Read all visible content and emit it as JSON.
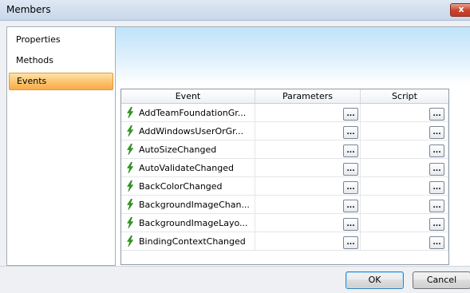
{
  "window": {
    "title": "Members",
    "close_label": "x"
  },
  "sidebar": {
    "items": [
      {
        "label": "Properties",
        "active": false
      },
      {
        "label": "Methods",
        "active": false
      },
      {
        "label": "Events",
        "active": true
      }
    ]
  },
  "grid": {
    "columns": [
      "Event",
      "Parameters",
      "Script"
    ],
    "rows": [
      {
        "event": "AddTeamFoundationGr...",
        "param_btn": "...",
        "script_btn": "..."
      },
      {
        "event": "AddWindowsUserOrGr...",
        "param_btn": "...",
        "script_btn": "..."
      },
      {
        "event": "AutoSizeChanged",
        "param_btn": "...",
        "script_btn": "..."
      },
      {
        "event": "AutoValidateChanged",
        "param_btn": "...",
        "script_btn": "..."
      },
      {
        "event": "BackColorChanged",
        "param_btn": "...",
        "script_btn": "..."
      },
      {
        "event": "BackgroundImageChan...",
        "param_btn": "...",
        "script_btn": "..."
      },
      {
        "event": "BackgroundImageLayo...",
        "param_btn": "...",
        "script_btn": "..."
      },
      {
        "event": "BindingContextChanged",
        "param_btn": "...",
        "script_btn": "..."
      }
    ]
  },
  "scrollbar": {
    "up_arrow": "▲",
    "down_arrow": "▼"
  },
  "buttons": {
    "ok": "OK",
    "cancel": "Cancel"
  },
  "colors": {
    "accent": "#fbc36c",
    "event_icon": "#2e9e1c",
    "close": "#c7432a"
  },
  "icons": {
    "event": "lightning-bolt-icon"
  }
}
